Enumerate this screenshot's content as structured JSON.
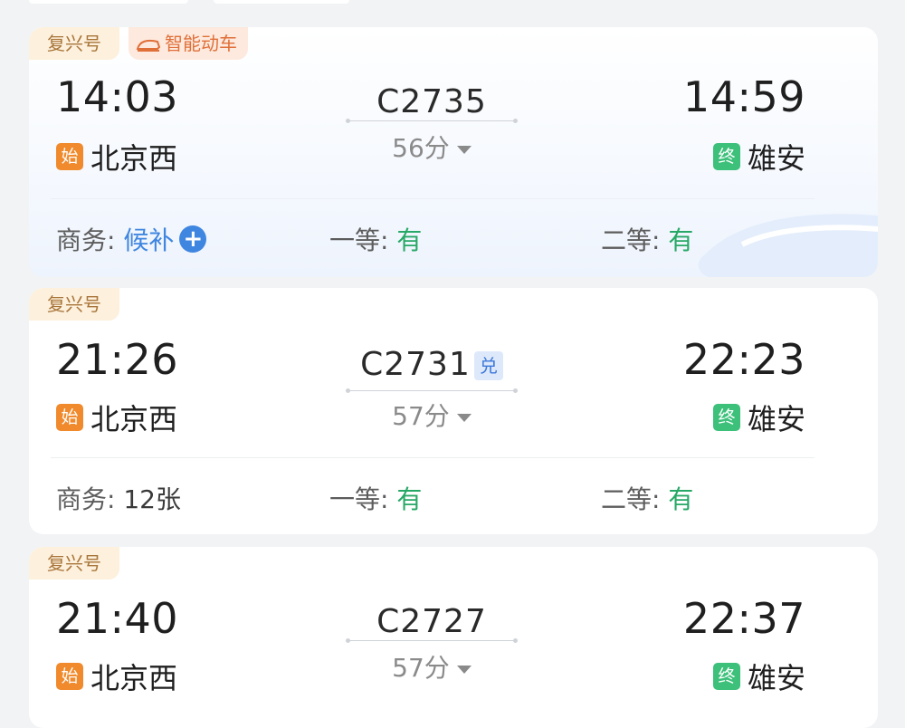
{
  "trains": [
    {
      "tags": [
        "复兴号"
      ],
      "smart_tag": "智能动车",
      "dep_time": "14:03",
      "arr_time": "14:59",
      "dep_station": "北京西",
      "arr_station": "雄安",
      "start_badge": "始",
      "end_badge": "终",
      "train_no": "C2735",
      "duration": "56分",
      "seats": [
        {
          "label": "商务:",
          "value": "候补",
          "color": "#3f86e0",
          "icon": "plus-circle-icon"
        },
        {
          "label": "一等:",
          "value": "有",
          "color": "#27a866"
        },
        {
          "label": "二等:",
          "value": "有",
          "color": "#27a866"
        }
      ]
    },
    {
      "tags": [
        "复兴号"
      ],
      "dep_time": "21:26",
      "arr_time": "22:23",
      "dep_station": "北京西",
      "arr_station": "雄安",
      "start_badge": "始",
      "end_badge": "终",
      "train_no": "C2731",
      "train_badge": "兑",
      "duration": "57分",
      "seats": [
        {
          "label": "商务:",
          "value": "12张",
          "color": "#3a3a3a"
        },
        {
          "label": "一等:",
          "value": "有",
          "color": "#27a866"
        },
        {
          "label": "二等:",
          "value": "有",
          "color": "#27a866"
        }
      ]
    },
    {
      "tags": [
        "复兴号"
      ],
      "dep_time": "21:40",
      "arr_time": "22:37",
      "dep_station": "北京西",
      "arr_station": "雄安",
      "start_badge": "始",
      "end_badge": "终",
      "train_no": "C2727",
      "duration": "57分"
    }
  ],
  "colors": {
    "tag_bg": "#fdf0dc",
    "tag_text": "#a8753a",
    "smart_tag_text": "#e0703a",
    "start_badge": "#f08a2c",
    "end_badge": "#3cc07a",
    "available_green": "#27a866",
    "waitlist_blue": "#3f86e0"
  }
}
